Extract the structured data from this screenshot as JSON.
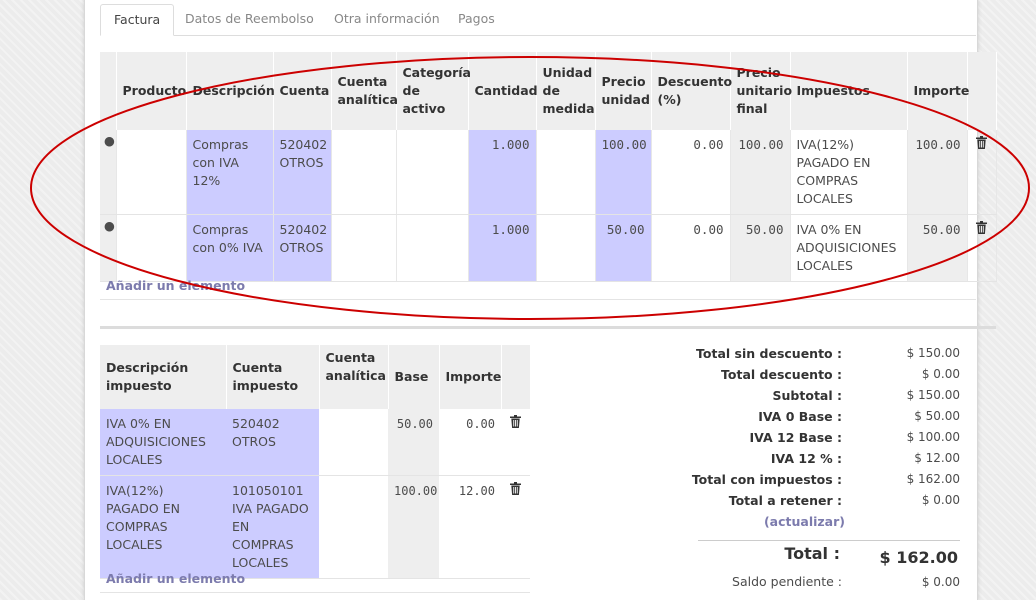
{
  "tabs": [
    "Factura",
    "Datos de Reembolso",
    "Otra información",
    "Pagos"
  ],
  "lines_table": {
    "headers": [
      "Producto",
      "Descripción",
      "Cuenta",
      "Cuenta analítica",
      "Categoría de activo",
      "Cantidad",
      "Unidad de medida",
      "Precio unidad",
      "Descuento (%)",
      "Precio unitario final",
      "Impuestos",
      "Importe"
    ],
    "rows": [
      {
        "producto": "",
        "descripcion": "Compras con IVA 12%",
        "cuenta": "520402 OTROS",
        "analitica": "",
        "categoria": "",
        "cantidad": "1.000",
        "unidad": "",
        "precio": "100.00",
        "descuento": "0.00",
        "precio_final": "100.00",
        "impuestos": "IVA(12%) PAGADO EN COMPRAS LOCALES",
        "importe": "100.00"
      },
      {
        "producto": "",
        "descripcion": "Compras con 0% IVA",
        "cuenta": "520402 OTROS",
        "analitica": "",
        "categoria": "",
        "cantidad": "1.000",
        "unidad": "",
        "precio": "50.00",
        "descuento": "0.00",
        "precio_final": "50.00",
        "impuestos": "IVA 0% EN ADQUISICIONES LOCALES",
        "importe": "50.00"
      }
    ],
    "add_label": "Añadir un elemento"
  },
  "tax_table": {
    "headers": [
      "Descripción impuesto",
      "Cuenta impuesto",
      "Cuenta analítica",
      "Base",
      "Importe"
    ],
    "rows": [
      {
        "descripcion": "IVA 0% EN ADQUISICIONES LOCALES",
        "cuenta": "520402 OTROS",
        "analitica": "",
        "base": "50.00",
        "importe": "0.00"
      },
      {
        "descripcion": "IVA(12%) PAGADO EN COMPRAS LOCALES",
        "cuenta": "101050101 IVA PAGADO EN COMPRAS LOCALES",
        "analitica": "",
        "base": "100.00",
        "importe": "12.00"
      }
    ],
    "add_label": "Añadir un elemento"
  },
  "totals": {
    "rows": [
      {
        "label": "Total sin descuento :",
        "value": "$ 150.00"
      },
      {
        "label": "Total descuento :",
        "value": "$ 0.00"
      },
      {
        "label": "Subtotal :",
        "value": "$ 150.00"
      },
      {
        "label": "IVA 0 Base :",
        "value": "$ 50.00"
      },
      {
        "label": "IVA 12 Base :",
        "value": "$ 100.00"
      },
      {
        "label": "IVA 12 % :",
        "value": "$ 12.00"
      },
      {
        "label": "Total con impuestos :",
        "value": "$ 162.00"
      },
      {
        "label": "Total a retener :",
        "value": "$ 0.00"
      }
    ],
    "update_link": "(actualizar)",
    "total_label": "Total :",
    "total_value": "$ 162.00",
    "pending_label": "Saldo pendiente :",
    "pending_value": "$ 0.00"
  },
  "colors": {
    "highlight": "#ccccff",
    "link": "#7c7bad",
    "annotation": "#cc0000"
  }
}
